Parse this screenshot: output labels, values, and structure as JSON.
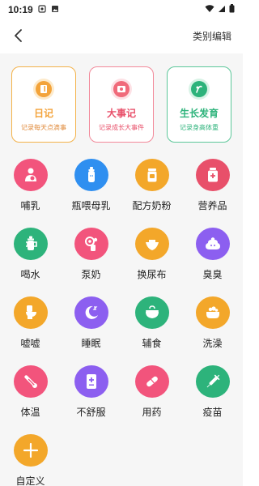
{
  "status_bar": {
    "time": "10:19"
  },
  "header": {
    "edit_label": "类别编辑"
  },
  "cards": [
    {
      "title": "日记",
      "subtitle": "记录每天点滴事",
      "color": "#f3a33a",
      "icon": "diary-icon"
    },
    {
      "title": "大事记",
      "subtitle": "记录成长大事件",
      "color": "#f06a7a",
      "icon": "event-camera-icon"
    },
    {
      "title": "生长发育",
      "subtitle": "记录身高体重",
      "color": "#2db37b",
      "icon": "growth-icon"
    }
  ],
  "categories": [
    {
      "label": "哺乳",
      "color": "#f2547c",
      "icon": "breastfeeding-icon"
    },
    {
      "label": "瓶喂母乳",
      "color": "#2f8ff0",
      "icon": "bottle-icon"
    },
    {
      "label": "配方奶粉",
      "color": "#f3a72a",
      "icon": "formula-can-icon"
    },
    {
      "label": "营养品",
      "color": "#e8506a",
      "icon": "supplement-icon"
    },
    {
      "label": "喝水",
      "color": "#2db37b",
      "icon": "sippy-cup-icon"
    },
    {
      "label": "泵奶",
      "color": "#f2547c",
      "icon": "breast-pump-icon"
    },
    {
      "label": "换尿布",
      "color": "#f3a72a",
      "icon": "diaper-icon"
    },
    {
      "label": "臭臭",
      "color": "#8c5ff0",
      "icon": "poop-icon"
    },
    {
      "label": "嘘嘘",
      "color": "#f3a72a",
      "icon": "toilet-icon"
    },
    {
      "label": "睡眠",
      "color": "#8c5ff0",
      "icon": "moon-icon"
    },
    {
      "label": "辅食",
      "color": "#2db37b",
      "icon": "food-bowl-icon"
    },
    {
      "label": "洗澡",
      "color": "#f3a72a",
      "icon": "bathtub-icon"
    },
    {
      "label": "体温",
      "color": "#f2547c",
      "icon": "thermometer-icon"
    },
    {
      "label": "不舒服",
      "color": "#8c5ff0",
      "icon": "medical-record-icon"
    },
    {
      "label": "用药",
      "color": "#f2547c",
      "icon": "pill-icon"
    },
    {
      "label": "疫苗",
      "color": "#2db37b",
      "icon": "syringe-icon"
    },
    {
      "label": "自定义",
      "color": "#f3a72a",
      "icon": "plus-icon"
    }
  ]
}
